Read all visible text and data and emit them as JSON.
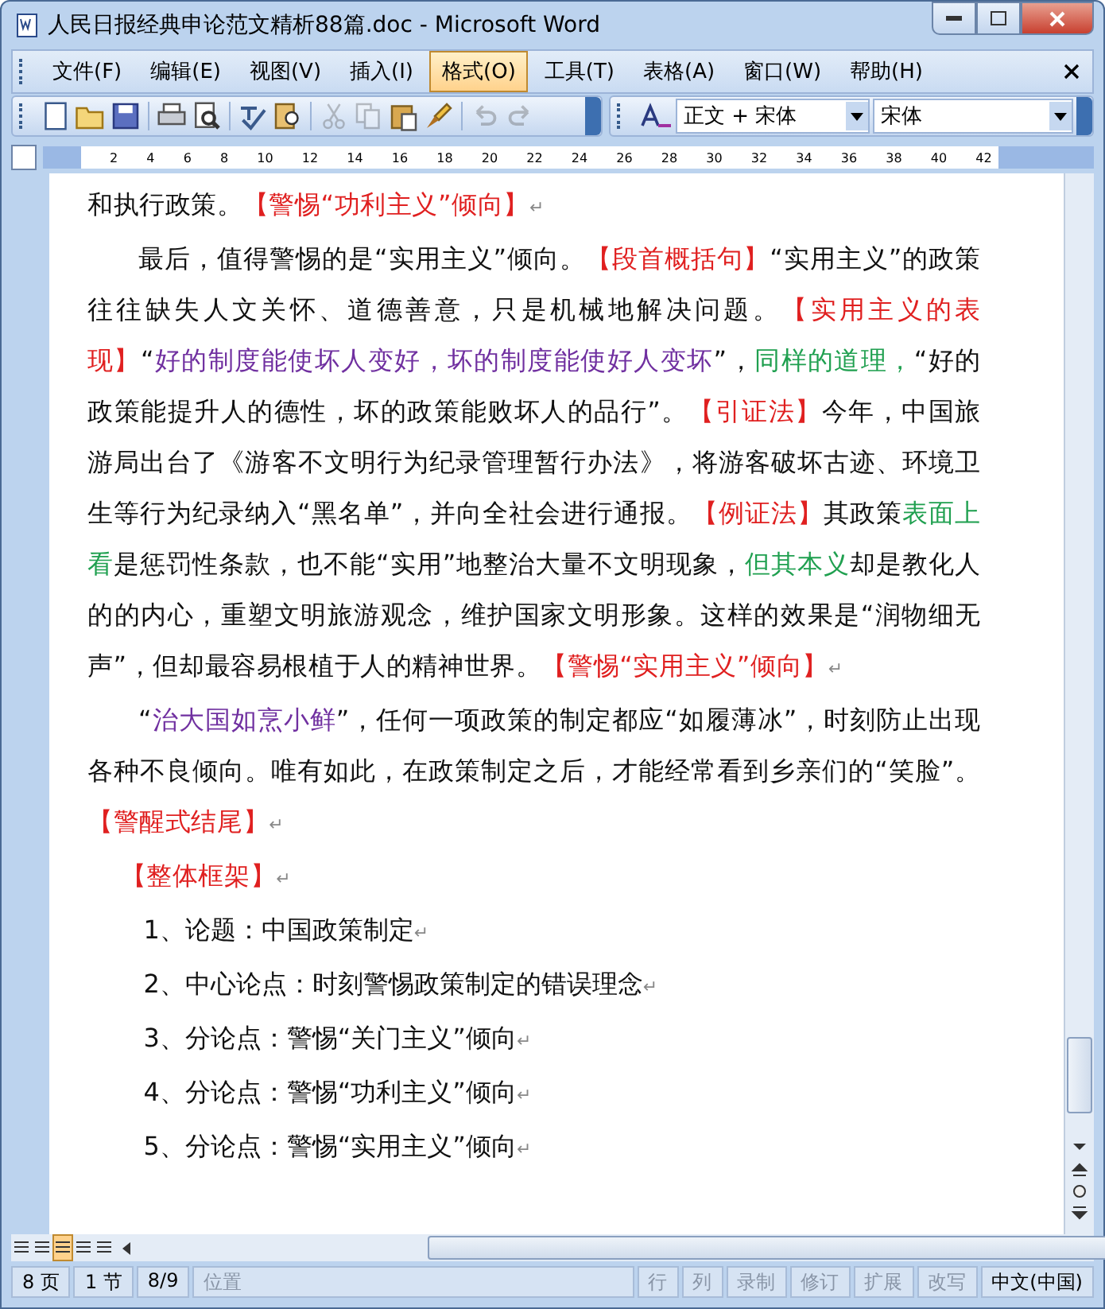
{
  "window": {
    "title": "人民日报经典申论范文精析88篇.doc - Microsoft Word"
  },
  "menu": [
    {
      "label": "文件(F)",
      "selected": false
    },
    {
      "label": "编辑(E)",
      "selected": false
    },
    {
      "label": "视图(V)",
      "selected": false
    },
    {
      "label": "插入(I)",
      "selected": false
    },
    {
      "label": "格式(O)",
      "selected": true
    },
    {
      "label": "工具(T)",
      "selected": false
    },
    {
      "label": "表格(A)",
      "selected": false
    },
    {
      "label": "窗口(W)",
      "selected": false
    },
    {
      "label": "帮助(H)",
      "selected": false
    }
  ],
  "toolbar": {
    "groups": [
      [
        {
          "kind": "new",
          "disabled": false
        },
        {
          "kind": "open",
          "disabled": false
        },
        {
          "kind": "save",
          "disabled": false
        }
      ],
      [
        {
          "kind": "print",
          "disabled": false
        },
        {
          "kind": "preview",
          "disabled": false
        }
      ],
      [
        {
          "kind": "spell",
          "disabled": false
        },
        {
          "kind": "research",
          "disabled": false
        }
      ],
      [
        {
          "kind": "cut",
          "disabled": true
        },
        {
          "kind": "copy",
          "disabled": true
        },
        {
          "kind": "paste",
          "disabled": false
        },
        {
          "kind": "brush",
          "disabled": false
        }
      ],
      [
        {
          "kind": "undo",
          "disabled": true
        },
        {
          "kind": "redo",
          "disabled": true
        }
      ]
    ],
    "style": "正文 + 宋体",
    "font": "宋体"
  },
  "ruler": {
    "ticks": [
      "2",
      "4",
      "6",
      "8",
      "10",
      "12",
      "14",
      "16",
      "18",
      "20",
      "22",
      "24",
      "26",
      "28",
      "30",
      "32",
      "34",
      "36",
      "38",
      "40",
      "42"
    ]
  },
  "document": {
    "paragraphs": [
      {
        "kind": "plain",
        "segments": [
          {
            "kind": "text",
            "text": "和执行政策。"
          },
          {
            "kind": "tag",
            "text": "【警惕“功利主义”倾向】"
          },
          {
            "kind": "mark",
            "text": "↵"
          }
        ]
      },
      {
        "kind": "indent",
        "segments": [
          {
            "kind": "text",
            "text": "最后，值得警惕的是“实用主义”倾向。"
          },
          {
            "kind": "tag",
            "text": "【段首概括句】"
          },
          {
            "kind": "text",
            "text": "“实用主义”的政策往往缺失人文关怀、道德善意，只是机械地解决问题。"
          },
          {
            "kind": "tag",
            "text": "【实用主义的表现】"
          },
          {
            "kind": "text",
            "text": "“"
          },
          {
            "kind": "quote",
            "text": "好的制度能使坏人变好，坏的制度能使好人变坏"
          },
          {
            "kind": "text",
            "text": "”，"
          },
          {
            "kind": "note",
            "text": "同样的道理，"
          },
          {
            "kind": "text",
            "text": "“好的政策能提升人的德性，坏的政策能败坏人的品行”。"
          },
          {
            "kind": "tag",
            "text": "【引证法】"
          },
          {
            "kind": "text",
            "text": "今年，中国旅游局出台了《游客不文明行为纪录管理暂行办法》，将游客破坏古迹、环境卫生等行为纪录纳入“黑名单”，并向全社会进行通报。"
          },
          {
            "kind": "tag",
            "text": "【例证法】"
          },
          {
            "kind": "text",
            "text": "其政策"
          },
          {
            "kind": "note",
            "text": "表面上看"
          },
          {
            "kind": "text",
            "text": "是惩罚性条款，也不能“实用”地整治大量不文明现象，"
          },
          {
            "kind": "note",
            "text": "但其本义"
          },
          {
            "kind": "text",
            "text": "却是教化人的的内心，重塑文明旅游观念，维护国家文明形象。这样的效果是“润物细无声”，但却最容易根植于人的精神世界。"
          },
          {
            "kind": "tag",
            "text": "【警惕“实用主义”倾向】"
          },
          {
            "kind": "mark",
            "text": "↵"
          }
        ]
      },
      {
        "kind": "indent",
        "segments": [
          {
            "kind": "text",
            "text": "“"
          },
          {
            "kind": "quote",
            "text": "治大国如烹小鲜"
          },
          {
            "kind": "text",
            "text": "”，任何一项政策的制定都应“如履薄冰”，时刻防止出现各种不良倾向。唯有如此，在政策制定之后，才能经常看到乡亲们的“笑脸”。"
          },
          {
            "kind": "tag",
            "text": "【警醒式结尾】"
          },
          {
            "kind": "mark",
            "text": "↵"
          }
        ]
      },
      {
        "kind": "heading",
        "segments": [
          {
            "kind": "tag",
            "text": "【整体框架】"
          },
          {
            "kind": "mark",
            "text": "↵"
          }
        ]
      },
      {
        "kind": "list",
        "segments": [
          {
            "kind": "text",
            "text": "1、论题：中国政策制定"
          },
          {
            "kind": "mark",
            "text": "↵"
          }
        ]
      },
      {
        "kind": "list",
        "segments": [
          {
            "kind": "text",
            "text": "2、中心论点：时刻警惕政策制定的错误理念"
          },
          {
            "kind": "mark",
            "text": "↵"
          }
        ]
      },
      {
        "kind": "list",
        "segments": [
          {
            "kind": "text",
            "text": "3、分论点：警惕“关门主义”倾向"
          },
          {
            "kind": "mark",
            "text": "↵"
          }
        ]
      },
      {
        "kind": "list",
        "segments": [
          {
            "kind": "text",
            "text": "4、分论点：警惕“功利主义”倾向"
          },
          {
            "kind": "mark",
            "text": "↵"
          }
        ]
      },
      {
        "kind": "list",
        "segments": [
          {
            "kind": "text",
            "text": "5、分论点：警惕“实用主义”倾向"
          },
          {
            "kind": "mark",
            "text": "↵"
          }
        ]
      }
    ]
  },
  "view_buttons": [
    {
      "selected": false
    },
    {
      "selected": false
    },
    {
      "selected": true
    },
    {
      "selected": false
    },
    {
      "selected": false
    }
  ],
  "status_bar": {
    "items": [
      {
        "text": "8 页",
        "disabled": false
      },
      {
        "text": "1 节",
        "disabled": false
      },
      {
        "text": "8/9",
        "disabled": false
      },
      {
        "text": "位置",
        "disabled": true
      },
      {
        "text": "行",
        "disabled": true
      },
      {
        "text": "列",
        "disabled": true
      },
      {
        "text": "录制",
        "disabled": true
      },
      {
        "text": "修订",
        "disabled": true
      },
      {
        "text": "扩展",
        "disabled": true
      },
      {
        "text": "改写",
        "disabled": true
      },
      {
        "text": "中文(中国)",
        "disabled": false
      }
    ]
  }
}
